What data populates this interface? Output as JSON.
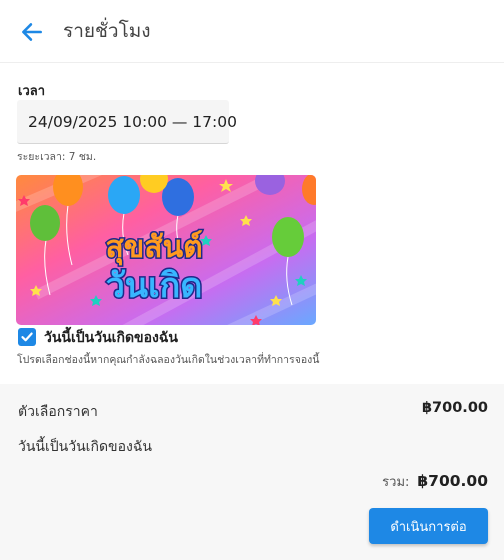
{
  "header": {
    "title": "รายชั่วโมง",
    "back_icon": "arrow-left-icon",
    "accent_color": "#1e88e5"
  },
  "time": {
    "label": "เวลา",
    "value": "24/09/2025 10:00 — 17:00",
    "duration": "ระยะเวลา: 7 ชม."
  },
  "banner": {
    "line1": "สุขสันต์",
    "line2": "วันเกิด"
  },
  "birthday": {
    "checked": true,
    "label": "วันนี้เป็นวันเกิดของฉัน",
    "hint": "โปรดเลือกช่องนี้หากคุณกำลังฉลองวันเกิดในช่วงเวลาที่ทำการจองนี้"
  },
  "summary": {
    "option_label": "ตัวเลือกราคา",
    "option_price": "฿700.00",
    "option_detail": "วันนี้เป็นวันเกิดของฉัน",
    "total_label": "รวม:",
    "total_value": "฿700.00",
    "continue_label": "ดำเนินการต่อ"
  }
}
